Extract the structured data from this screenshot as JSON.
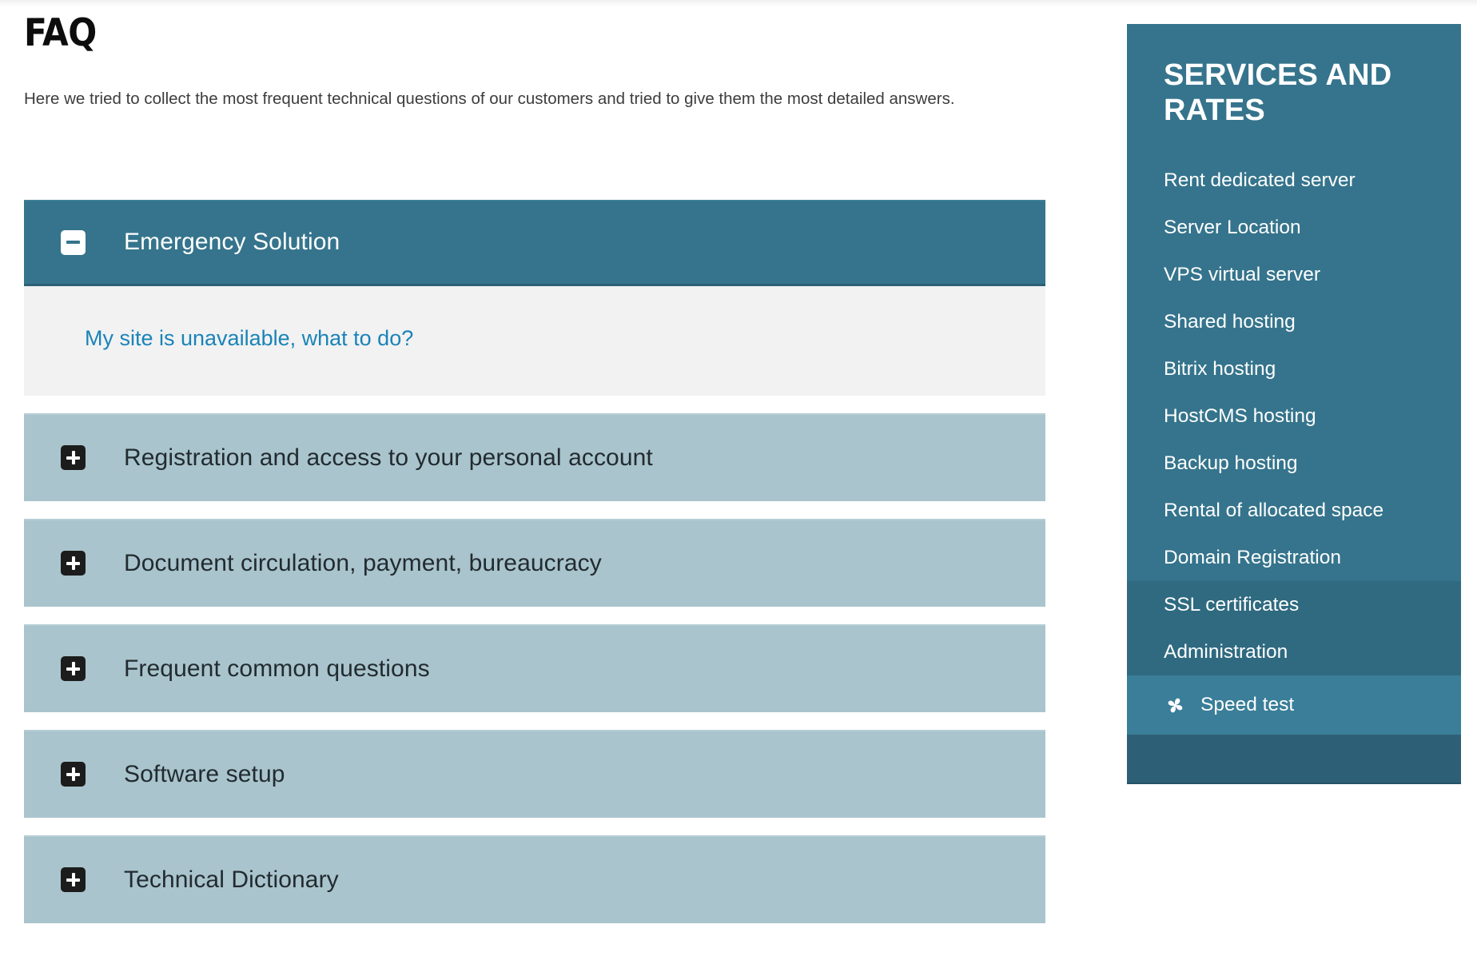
{
  "main": {
    "title": "FAQ",
    "intro": "Here we tried to collect the most frequent technical questions of our customers and tried to give them the most detailed answers.",
    "accordion": [
      {
        "label": "Emergency Solution",
        "state": "open",
        "icon": "minus-icon",
        "links": [
          "My site is unavailable, what to do?"
        ]
      },
      {
        "label": "Registration and access to your personal account",
        "state": "closed",
        "icon": "plus-icon",
        "links": []
      },
      {
        "label": "Document circulation, payment, bureaucracy",
        "state": "closed",
        "icon": "plus-icon",
        "links": []
      },
      {
        "label": "Frequent common questions",
        "state": "closed",
        "icon": "plus-icon",
        "links": []
      },
      {
        "label": "Software setup",
        "state": "closed",
        "icon": "plus-icon",
        "links": []
      },
      {
        "label": "Technical Dictionary",
        "state": "closed",
        "icon": "plus-icon",
        "links": []
      }
    ]
  },
  "sidebar": {
    "title": "SERVICES AND RATES",
    "items": [
      {
        "label": "Rent dedicated server"
      },
      {
        "label": "Server Location"
      },
      {
        "label": "VPS virtual server"
      },
      {
        "label": "Shared hosting"
      },
      {
        "label": "Bitrix hosting"
      },
      {
        "label": "HostCMS hosting"
      },
      {
        "label": "Backup hosting"
      },
      {
        "label": "Rental of allocated space"
      },
      {
        "label": "Domain Registration"
      },
      {
        "label": "SSL certificates"
      },
      {
        "label": "Administration"
      },
      {
        "label": "Speed test",
        "icon": "fan-icon",
        "active": true
      }
    ]
  },
  "colors": {
    "accent_teal": "#35748c",
    "panel_closed": "#a9c4cc",
    "panel_body": "#f2f2f2",
    "link_blue": "#1a83b8",
    "sidebar_active": "#3a7e99",
    "sidebar_footer": "#2d6077",
    "title_black": "#0d0d0d"
  }
}
